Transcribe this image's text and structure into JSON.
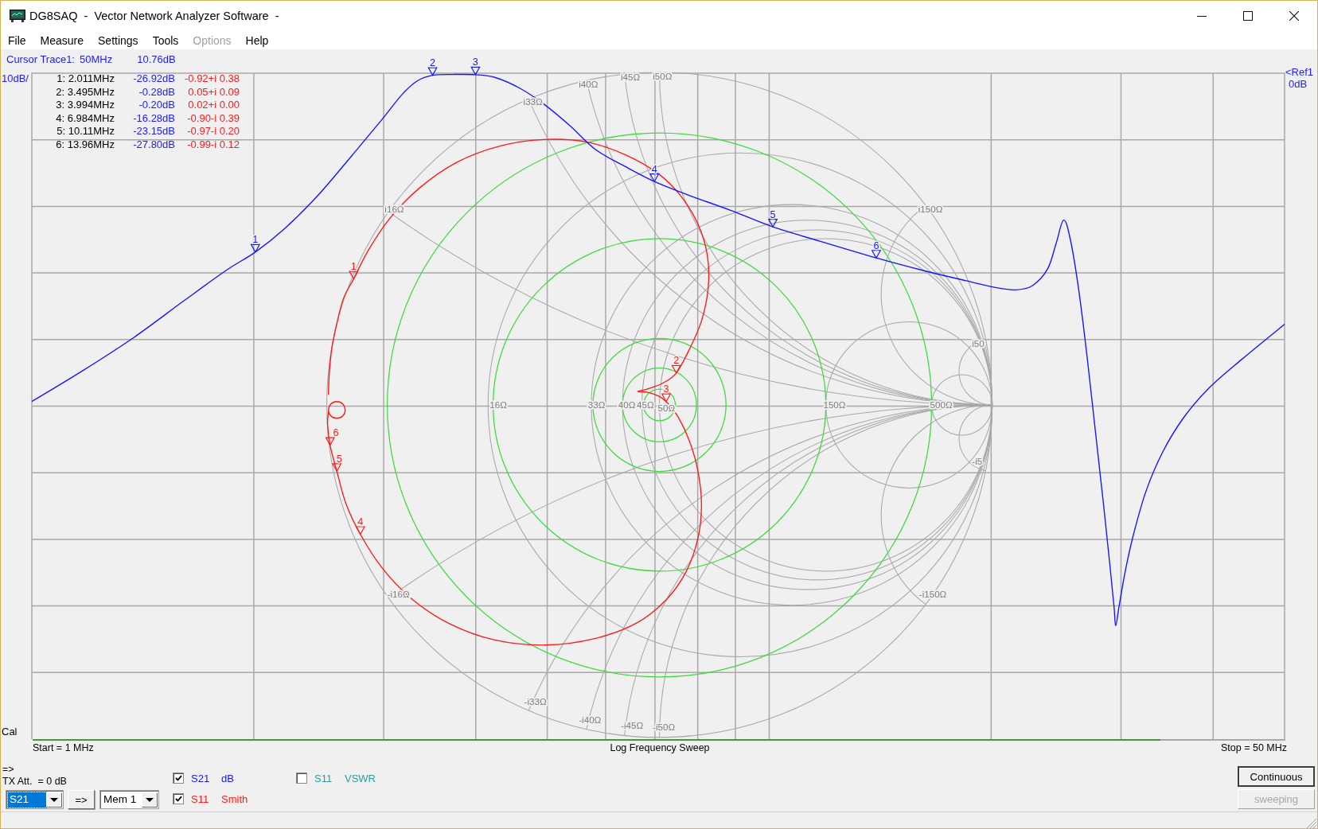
{
  "window": {
    "title": "DG8SAQ  -  Vector Network Analyzer Software  -"
  },
  "menu": [
    {
      "label": "File",
      "disabled": false
    },
    {
      "label": "Measure",
      "disabled": false
    },
    {
      "label": "Settings",
      "disabled": false
    },
    {
      "label": "Tools",
      "disabled": false
    },
    {
      "label": "Options",
      "disabled": true
    },
    {
      "label": "Help",
      "disabled": false
    }
  ],
  "cursor": {
    "label": "Cursor Trace1:",
    "frequency": "50MHz",
    "value": "10.76dB"
  },
  "plot": {
    "scale": "10dB/",
    "reference": "<Ref1",
    "reference_value": "0dB",
    "cal": "Cal",
    "marker_table": [
      {
        "marker": "1: 2.011MHz",
        "s21": "-26.92dB",
        "s11": "-0.92+i 0.38"
      },
      {
        "marker": "2: 3.495MHz",
        "s21": "-0.28dB",
        "s11": "0.05+i 0.09"
      },
      {
        "marker": "3: 3.994MHz",
        "s21": "-0.20dB",
        "s11": "0.02+i 0.00"
      },
      {
        "marker": "4: 6.984MHz",
        "s21": "-16.28dB",
        "s11": "-0.90-i 0.39"
      },
      {
        "marker": "5: 10.11MHz",
        "s21": "-23.15dB",
        "s11": "-0.97-i 0.20"
      },
      {
        "marker": "6: 13.96MHz",
        "s21": "-27.80dB",
        "s11": "-0.99-i 0.12"
      }
    ],
    "s21_markers": [
      "1",
      "2",
      "3",
      "4",
      "5",
      "6"
    ],
    "s11_markers": [
      "1",
      "2",
      "3",
      "4",
      "5",
      "6"
    ],
    "smith_labels": {
      "resistance": [
        "16Ω",
        "33Ω",
        "40Ω",
        "45Ω",
        "50Ω",
        "150Ω",
        "500Ω"
      ],
      "reactance": [
        "i16Ω",
        "i33Ω",
        "i40Ω",
        "i45Ω",
        "i50Ω",
        "i150Ω",
        "i50"
      ],
      "negative_reactance": [
        "-i16Ω",
        "-i33Ω",
        "-i40Ω",
        "-i45Ω",
        "-i50Ω",
        "-i150Ω",
        "-i5"
      ]
    }
  },
  "sweep": {
    "start": "Start = 1 MHz",
    "mode": "Log Frequency Sweep",
    "stop": "Stop = 50 MHz",
    "level": 0.9
  },
  "controls": {
    "arrow": "=>",
    "tx_attenuation": "TX Att.  = 0 dB",
    "trace_select": {
      "value": "S21",
      "highlighted": true
    },
    "transfer_button": "=>",
    "memory_select": {
      "value": "Mem 1",
      "highlighted": false
    }
  },
  "trace_toggles": [
    {
      "parameter": "S21",
      "format": "dB",
      "checked": true,
      "color": "#1414ff"
    },
    {
      "parameter": "S11",
      "format": "Smith",
      "checked": true,
      "color": "#ff1a1a"
    },
    {
      "parameter": "S11",
      "format": "VSWR",
      "checked": false,
      "color": "#2e9c9c"
    }
  ],
  "buttons": [
    {
      "label": "Continuous",
      "default": true,
      "disabled": false
    },
    {
      "label": "sweeping",
      "default": false,
      "disabled": true
    }
  ]
}
